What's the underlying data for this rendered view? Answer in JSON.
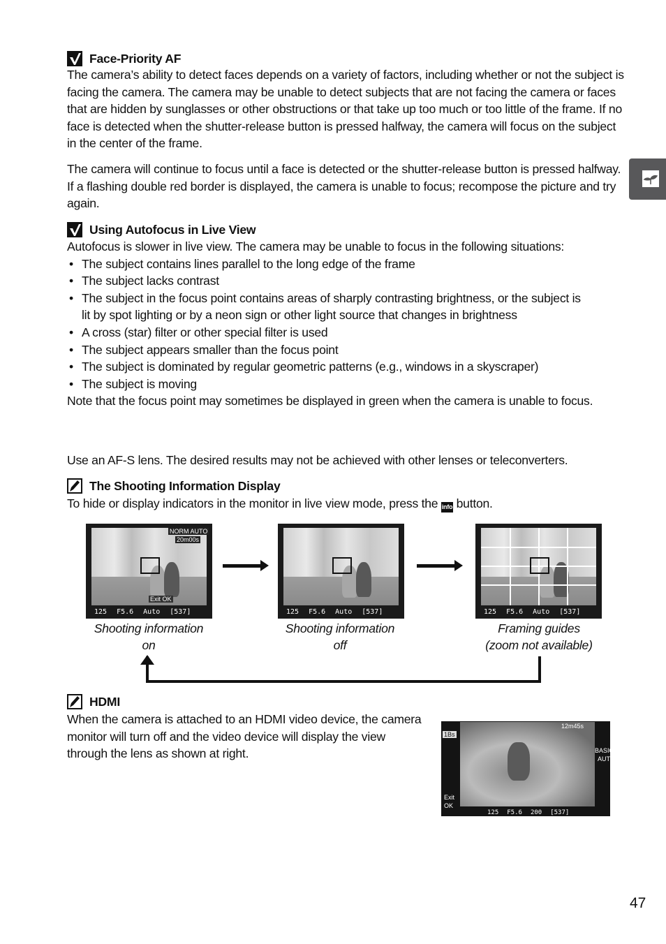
{
  "sections": {
    "face_priority": {
      "icon": "check-note-icon",
      "title": "Face-Priority AF",
      "p1": "The camera’s ability to detect faces depends on a variety of factors, including whether or not the subject is facing the camera.  The camera may be unable to detect subjects that are not facing the camera or faces that are hidden by sunglasses or other obstructions or that take up too much or too little of the frame.  If no face is detected when the shutter-release button is pressed halfway, the camera will focus on the subject in the center of the frame.",
      "p2": "The camera will continue to focus until a face is detected or the shutter-release button is pressed halfway.  If a flashing double red border is displayed, the camera is unable to focus; recompose the picture and try again."
    },
    "autofocus": {
      "icon": "check-note-icon",
      "title": "Using Autofocus in Live View",
      "intro": "Autofocus is slower in live view.  The camera may be unable to focus in the following situations:",
      "items": [
        "The subject contains lines parallel to the long edge of the frame",
        "The subject lacks contrast",
        "The subject in the focus point contains areas of sharply contrasting brightness, or the subject is lit by spot lighting or by a neon sign or other light source that changes in brightness",
        "A cross (star) filter or other special filter is used",
        "The subject appears smaller than the focus point",
        "The subject is dominated by regular geometric patterns (e.g., windows in a skyscraper)",
        "The subject is moving"
      ],
      "note": "Note that the focus point may sometimes be displayed in green when the camera is unable to focus.",
      "p2": "Use an AF-S lens.  The desired results may not be achieved with other lenses or teleconverters."
    },
    "shooting_info": {
      "icon": "pencil-note-icon",
      "title": "The Shooting Information Display",
      "text_before": "To hide or display indicators in the monitor in live view mode, press the",
      "button_icon": "info-button-icon",
      "text_after": " button.",
      "screens": [
        {
          "caption_line1": "Shooting information",
          "caption_line2": "on",
          "top_readout": "NORM AUTO",
          "counter": "20m00s",
          "hint": "Exit OK"
        },
        {
          "caption_line1": "Shooting information",
          "caption_line2": "off"
        },
        {
          "caption_line1": "Framing guides",
          "caption_line2": "(zoom not available)"
        }
      ],
      "readout": {
        "shutter": "125",
        "aperture": "F5.6",
        "iso": "Auto",
        "remaining": "[537]"
      }
    },
    "hdmi": {
      "icon": "pencil-note-icon",
      "title": "HDMI",
      "text": "When the camera is attached to an HDMI video device, the camera monitor will turn off and the video device will display the view through the lens as shown at right.",
      "screen": {
        "timer": "1Bs",
        "counter": "12m45s",
        "quality": "BASIC",
        "wb": "AUTO",
        "exit": "Exit",
        "ok": "OK",
        "shutter": "125",
        "aperture": "F5.6",
        "iso": "200",
        "remaining": "[537]"
      }
    }
  },
  "side_tab": {
    "icon": "sprout-icon"
  },
  "page_number": "47"
}
